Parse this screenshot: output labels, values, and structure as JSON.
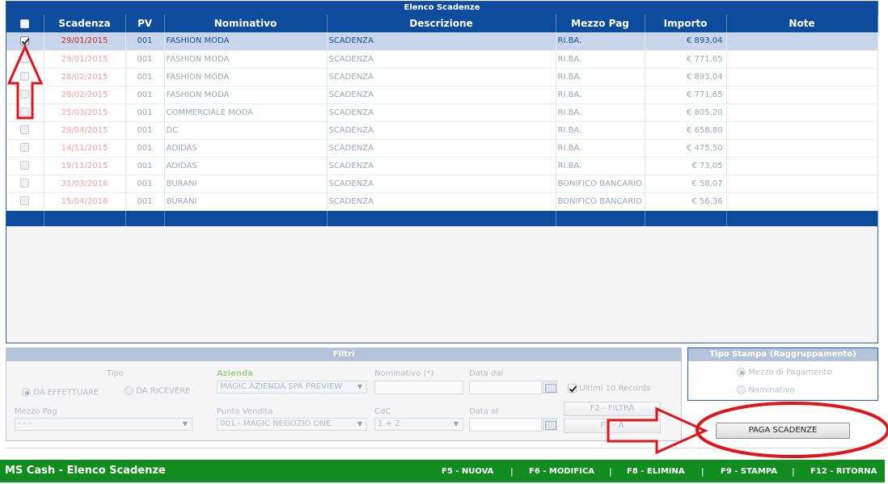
{
  "elenco": {
    "title": "Elenco Scadenze",
    "columns": [
      "",
      "Scadenza",
      "PV",
      "Nominativo",
      "Descrizione",
      "Mezzo Pag",
      "Importo",
      "Note"
    ],
    "rows": [
      {
        "checked": true,
        "scadenza": "29/01/2015",
        "pv": "001",
        "nominativo": "FASHION MODA",
        "descrizione": "SCADENZA",
        "mezzo": "RI.BA.",
        "importo": "€ 893,04",
        "note": ""
      },
      {
        "checked": false,
        "scadenza": "29/01/2015",
        "pv": "001",
        "nominativo": "FASHION MODA",
        "descrizione": "SCADENZA",
        "mezzo": "RI.BA.",
        "importo": "€ 771,65",
        "note": ""
      },
      {
        "checked": false,
        "scadenza": "28/02/2015",
        "pv": "001",
        "nominativo": "FASHION MODA",
        "descrizione": "SCADENZA",
        "mezzo": "RI.BA.",
        "importo": "€ 893,04",
        "note": ""
      },
      {
        "checked": false,
        "scadenza": "28/02/2015",
        "pv": "001",
        "nominativo": "FASHION MODA",
        "descrizione": "SCADENZA",
        "mezzo": "RI.BA.",
        "importo": "€ 771,65",
        "note": ""
      },
      {
        "checked": false,
        "scadenza": "25/03/2015",
        "pv": "001",
        "nominativo": "COMMERCIALE MODA",
        "descrizione": "SCADENZA",
        "mezzo": "RI.BA.",
        "importo": "€ 805,20",
        "note": ""
      },
      {
        "checked": false,
        "scadenza": "29/04/2015",
        "pv": "001",
        "nominativo": "DC",
        "descrizione": "SCADENZA",
        "mezzo": "RI.BA.",
        "importo": "€ 658,80",
        "note": ""
      },
      {
        "checked": false,
        "scadenza": "14/11/2015",
        "pv": "001",
        "nominativo": "ADIDAS",
        "descrizione": "SCADENZA",
        "mezzo": "RI.BA.",
        "importo": "€ 475,50",
        "note": ""
      },
      {
        "checked": false,
        "scadenza": "19/11/2015",
        "pv": "001",
        "nominativo": "ADIDAS",
        "descrizione": "SCADENZA",
        "mezzo": "RI.BA.",
        "importo": "€ 73,05",
        "note": ""
      },
      {
        "checked": false,
        "scadenza": "31/03/2016",
        "pv": "001",
        "nominativo": "BURANI",
        "descrizione": "SCADENZA",
        "mezzo": "BONIFICO BANCARIO",
        "importo": "€ 58,07",
        "note": ""
      },
      {
        "checked": false,
        "scadenza": "15/04/2016",
        "pv": "001",
        "nominativo": "BURANI",
        "descrizione": "SCADENZA",
        "mezzo": "BONIFICO BANCARIO",
        "importo": "€ 56,36",
        "note": ""
      }
    ]
  },
  "filtri": {
    "title": "Filtri",
    "tipo_label": "Tipo",
    "da_effettuare": "DA EFFETTUARE",
    "da_ricevere": "DA RICEVERE",
    "azienda_label": "Azienda",
    "azienda_value": "MAGIC AZIENDA SPA PREVIEW",
    "nominativo_label": "Nominativo (*)",
    "data_dal_label": "Data dal",
    "ultimi_label": "Ultimi 10 Records",
    "mezzo_label": "Mezzo Pag",
    "mezzo_value": "- - -",
    "punto_label": "Punto Vendita",
    "punto_value": "001 - MAGIC NEGOZIO ONE",
    "cdc_label": "CdC",
    "cdc_value": "1 + 2",
    "data_al_label": "Data al",
    "filtra_label": "F2 - FILTRA",
    "f3_label": "F3 - A"
  },
  "tipo_stampa": {
    "title": "Tipo Stampa (Raggruppamento)",
    "opt_mezzo": "Mezzo di Pagamento",
    "opt_nominativo": "Nominativo"
  },
  "paga_label": "PAGA SCADENZE",
  "bottombar": {
    "title": "MS Cash - Elenco Scadenze",
    "keys": [
      "F5 - NUOVA",
      "F6 - MODIFICA",
      "F8 - ELIMINA",
      "F9 - STAMPA",
      "F12 - RITORNA"
    ]
  },
  "colors": {
    "header_blue": "#0d4c9c",
    "selected_row": "#c7d6ea",
    "bottom_green": "#118c1f",
    "annotation_red": "#e0151b"
  }
}
